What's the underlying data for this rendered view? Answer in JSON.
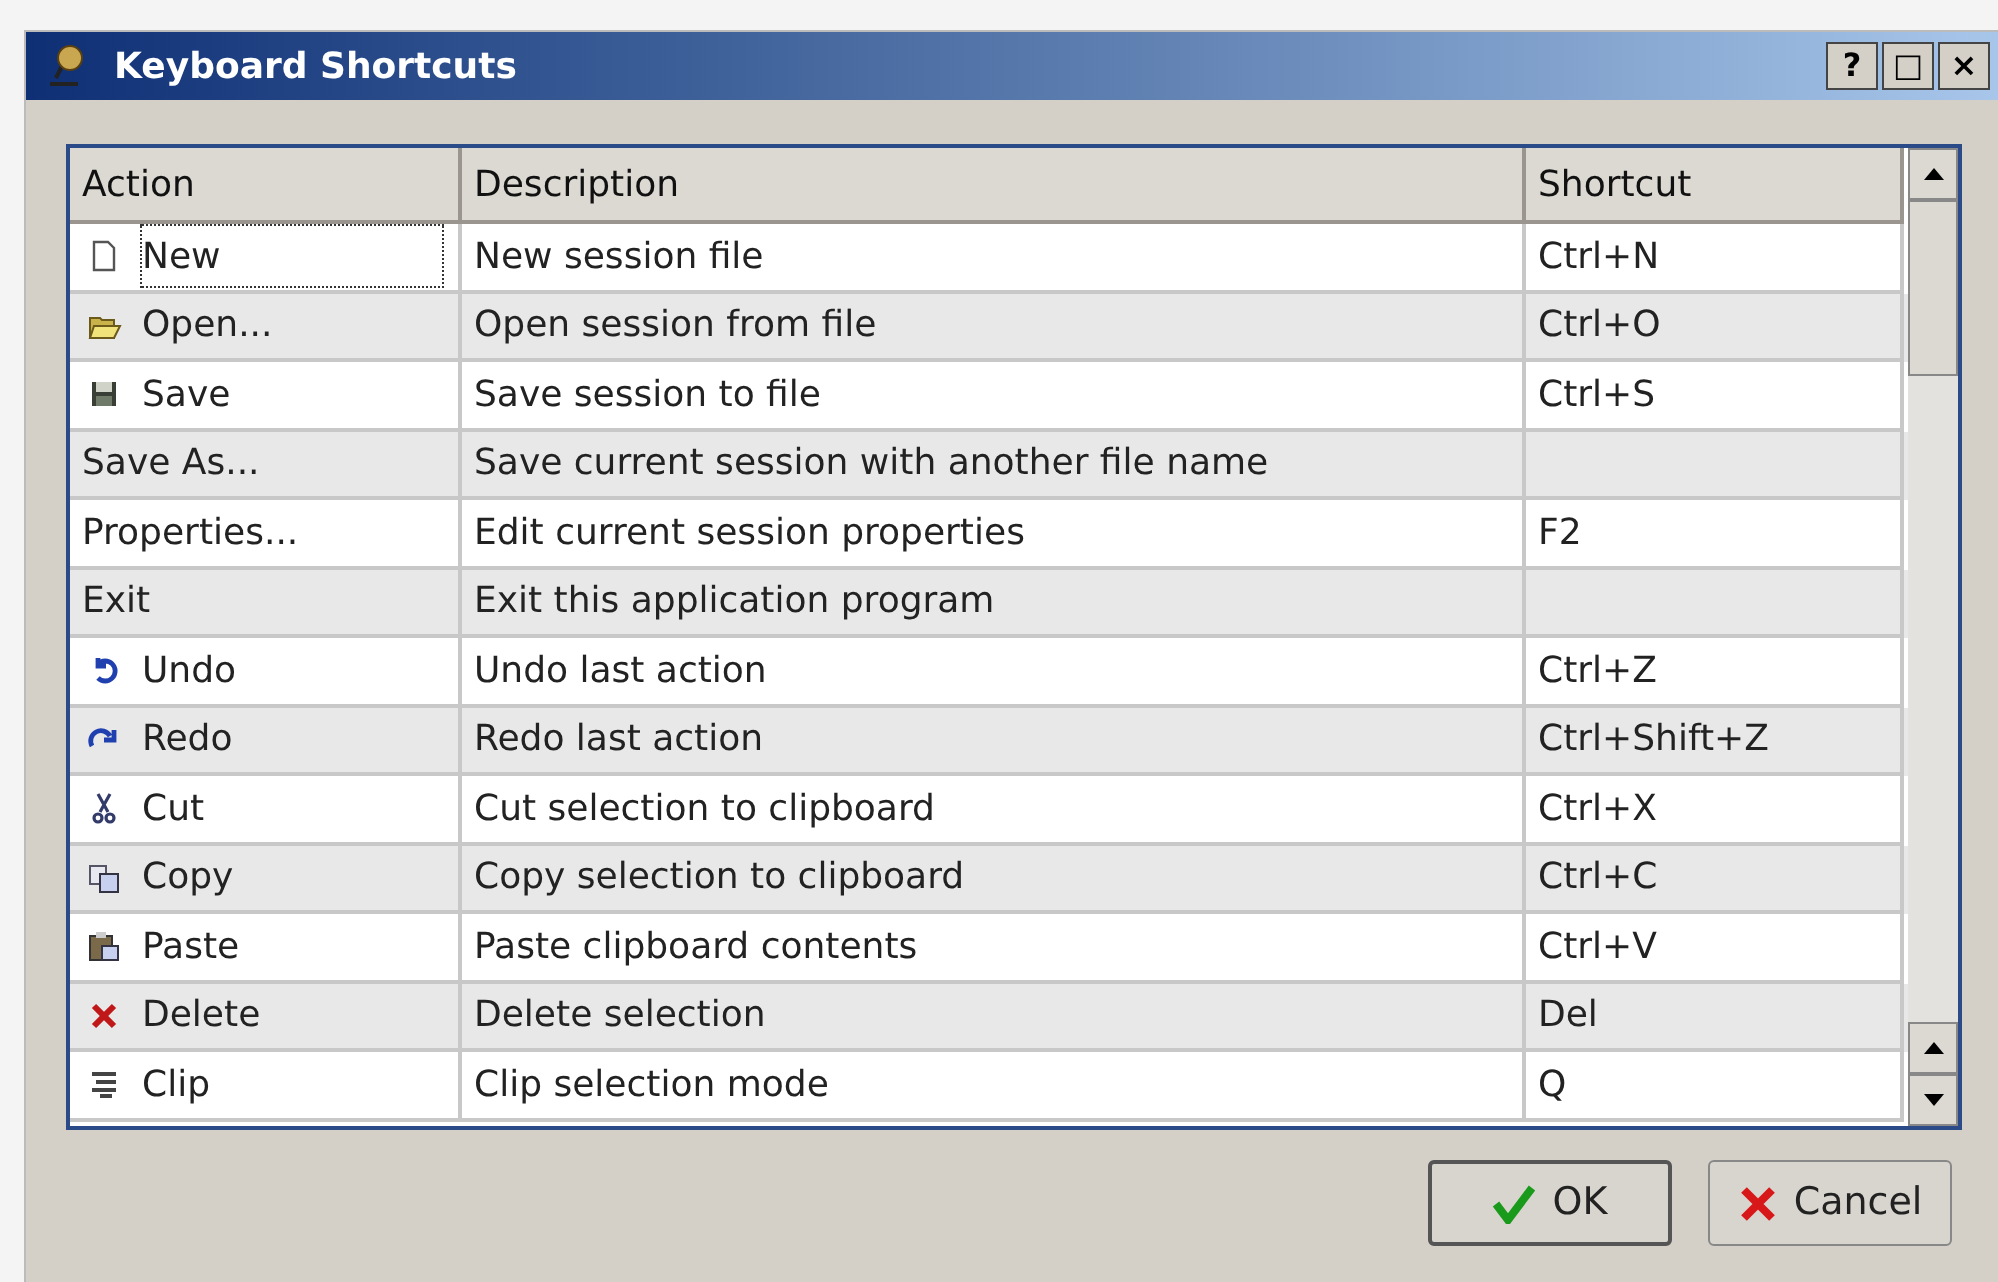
{
  "window": {
    "title": "Keyboard Shortcuts",
    "controls": [
      "?",
      "□",
      "×"
    ]
  },
  "table": {
    "columns": [
      "Action",
      "Description",
      "Shortcut"
    ],
    "rows": [
      {
        "action": "New",
        "description": "New session file",
        "shortcut": "Ctrl+N",
        "has_icon": true,
        "focused": true
      },
      {
        "action": "Open...",
        "description": "Open session from file",
        "shortcut": "Ctrl+O",
        "has_icon": true,
        "focused": false
      },
      {
        "action": "Save",
        "description": "Save session to file",
        "shortcut": "Ctrl+S",
        "has_icon": true,
        "focused": false
      },
      {
        "action": "Save As...",
        "description": "Save current session with another file name",
        "shortcut": "",
        "has_icon": false,
        "focused": false
      },
      {
        "action": "Properties...",
        "description": "Edit current session properties",
        "shortcut": "F2",
        "has_icon": false,
        "focused": false
      },
      {
        "action": "Exit",
        "description": "Exit this application program",
        "shortcut": "",
        "has_icon": false,
        "focused": false
      },
      {
        "action": "Undo",
        "description": "Undo last action",
        "shortcut": "Ctrl+Z",
        "has_icon": true,
        "focused": false
      },
      {
        "action": "Redo",
        "description": "Redo last action",
        "shortcut": "Ctrl+Shift+Z",
        "has_icon": true,
        "focused": false
      },
      {
        "action": "Cut",
        "description": "Cut selection to clipboard",
        "shortcut": "Ctrl+X",
        "has_icon": true,
        "focused": false
      },
      {
        "action": "Copy",
        "description": "Copy selection to clipboard",
        "shortcut": "Ctrl+C",
        "has_icon": true,
        "focused": false
      },
      {
        "action": "Paste",
        "description": "Paste clipboard contents",
        "shortcut": "Ctrl+V",
        "has_icon": true,
        "focused": false
      },
      {
        "action": "Delete",
        "description": "Delete selection",
        "shortcut": "Del",
        "has_icon": true,
        "focused": false
      },
      {
        "action": "Clip",
        "description": "Clip selection mode",
        "shortcut": "Q",
        "has_icon": true,
        "focused": false
      }
    ]
  },
  "buttons": [
    {
      "label": "OK",
      "kind": "ok",
      "default": true
    },
    {
      "label": "Cancel",
      "kind": "cancel",
      "default": false
    }
  ]
}
